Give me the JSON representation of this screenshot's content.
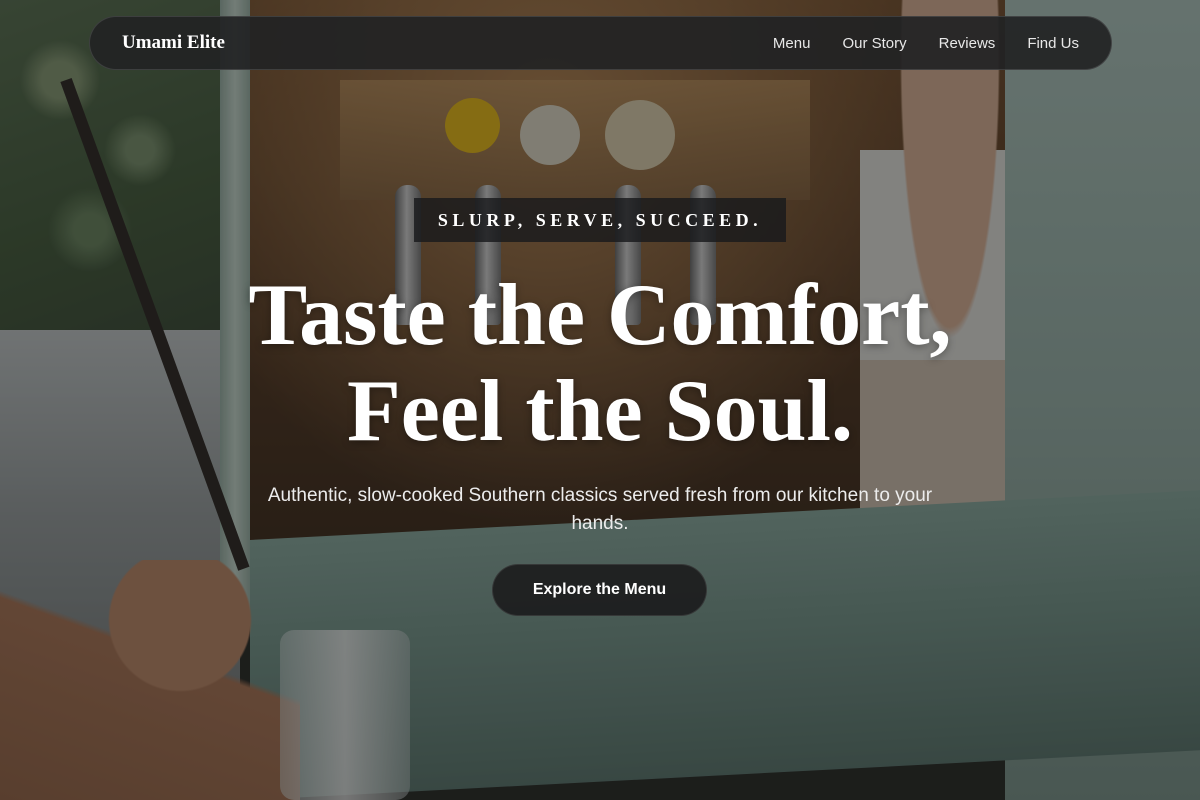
{
  "brand": {
    "name": "Umami Elite"
  },
  "nav": {
    "links": [
      {
        "label": "Menu"
      },
      {
        "label": "Our Story"
      },
      {
        "label": "Reviews"
      },
      {
        "label": "Find Us"
      }
    ]
  },
  "hero": {
    "tagline": "SLURP, SERVE, SUCCEED.",
    "headline_line1": "Taste the Comfort,",
    "headline_line2": "Feel the Soul.",
    "subtitle": "Authentic, slow-cooked Southern classics served fresh from our kitchen to your hands.",
    "cta_label": "Explore the Menu"
  },
  "background": {
    "photo_subject": "food-truck-serving-window",
    "overlay_color": "#0f0f0f"
  },
  "colors": {
    "nav_bg": "#222324",
    "button_bg": "#1e1f20",
    "text": "#ffffff"
  }
}
